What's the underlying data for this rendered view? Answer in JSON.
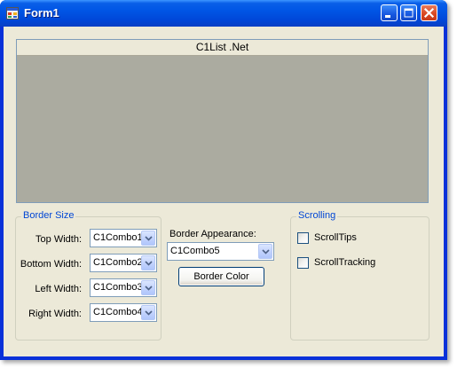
{
  "window": {
    "title": "Form1",
    "controls": [
      "minimize-icon",
      "maximize-icon",
      "close-icon"
    ]
  },
  "grid": {
    "caption": "C1List .Net"
  },
  "border_size": {
    "legend": "Border Size",
    "rows": [
      {
        "label": "Top Width:",
        "combo_value": "C1Combo1"
      },
      {
        "label": "Bottom Width:",
        "combo_value": "C1Combo2"
      },
      {
        "label": "Left Width:",
        "combo_value": "C1Combo3"
      },
      {
        "label": "Right Width:",
        "combo_value": "C1Combo4"
      }
    ]
  },
  "border_appearance": {
    "label": "Border Appearance:",
    "combo_value": "C1Combo5",
    "color_button_label": "Border Color"
  },
  "scrolling": {
    "legend": "Scrolling",
    "options": [
      {
        "label": "ScrollTips",
        "checked": false
      },
      {
        "label": "ScrollTracking",
        "checked": false
      }
    ]
  },
  "colors": {
    "titlebar": "#0055e5",
    "client_background": "#ece9d8",
    "grid_background": "#ababa0",
    "legend_text": "#0046d5"
  }
}
